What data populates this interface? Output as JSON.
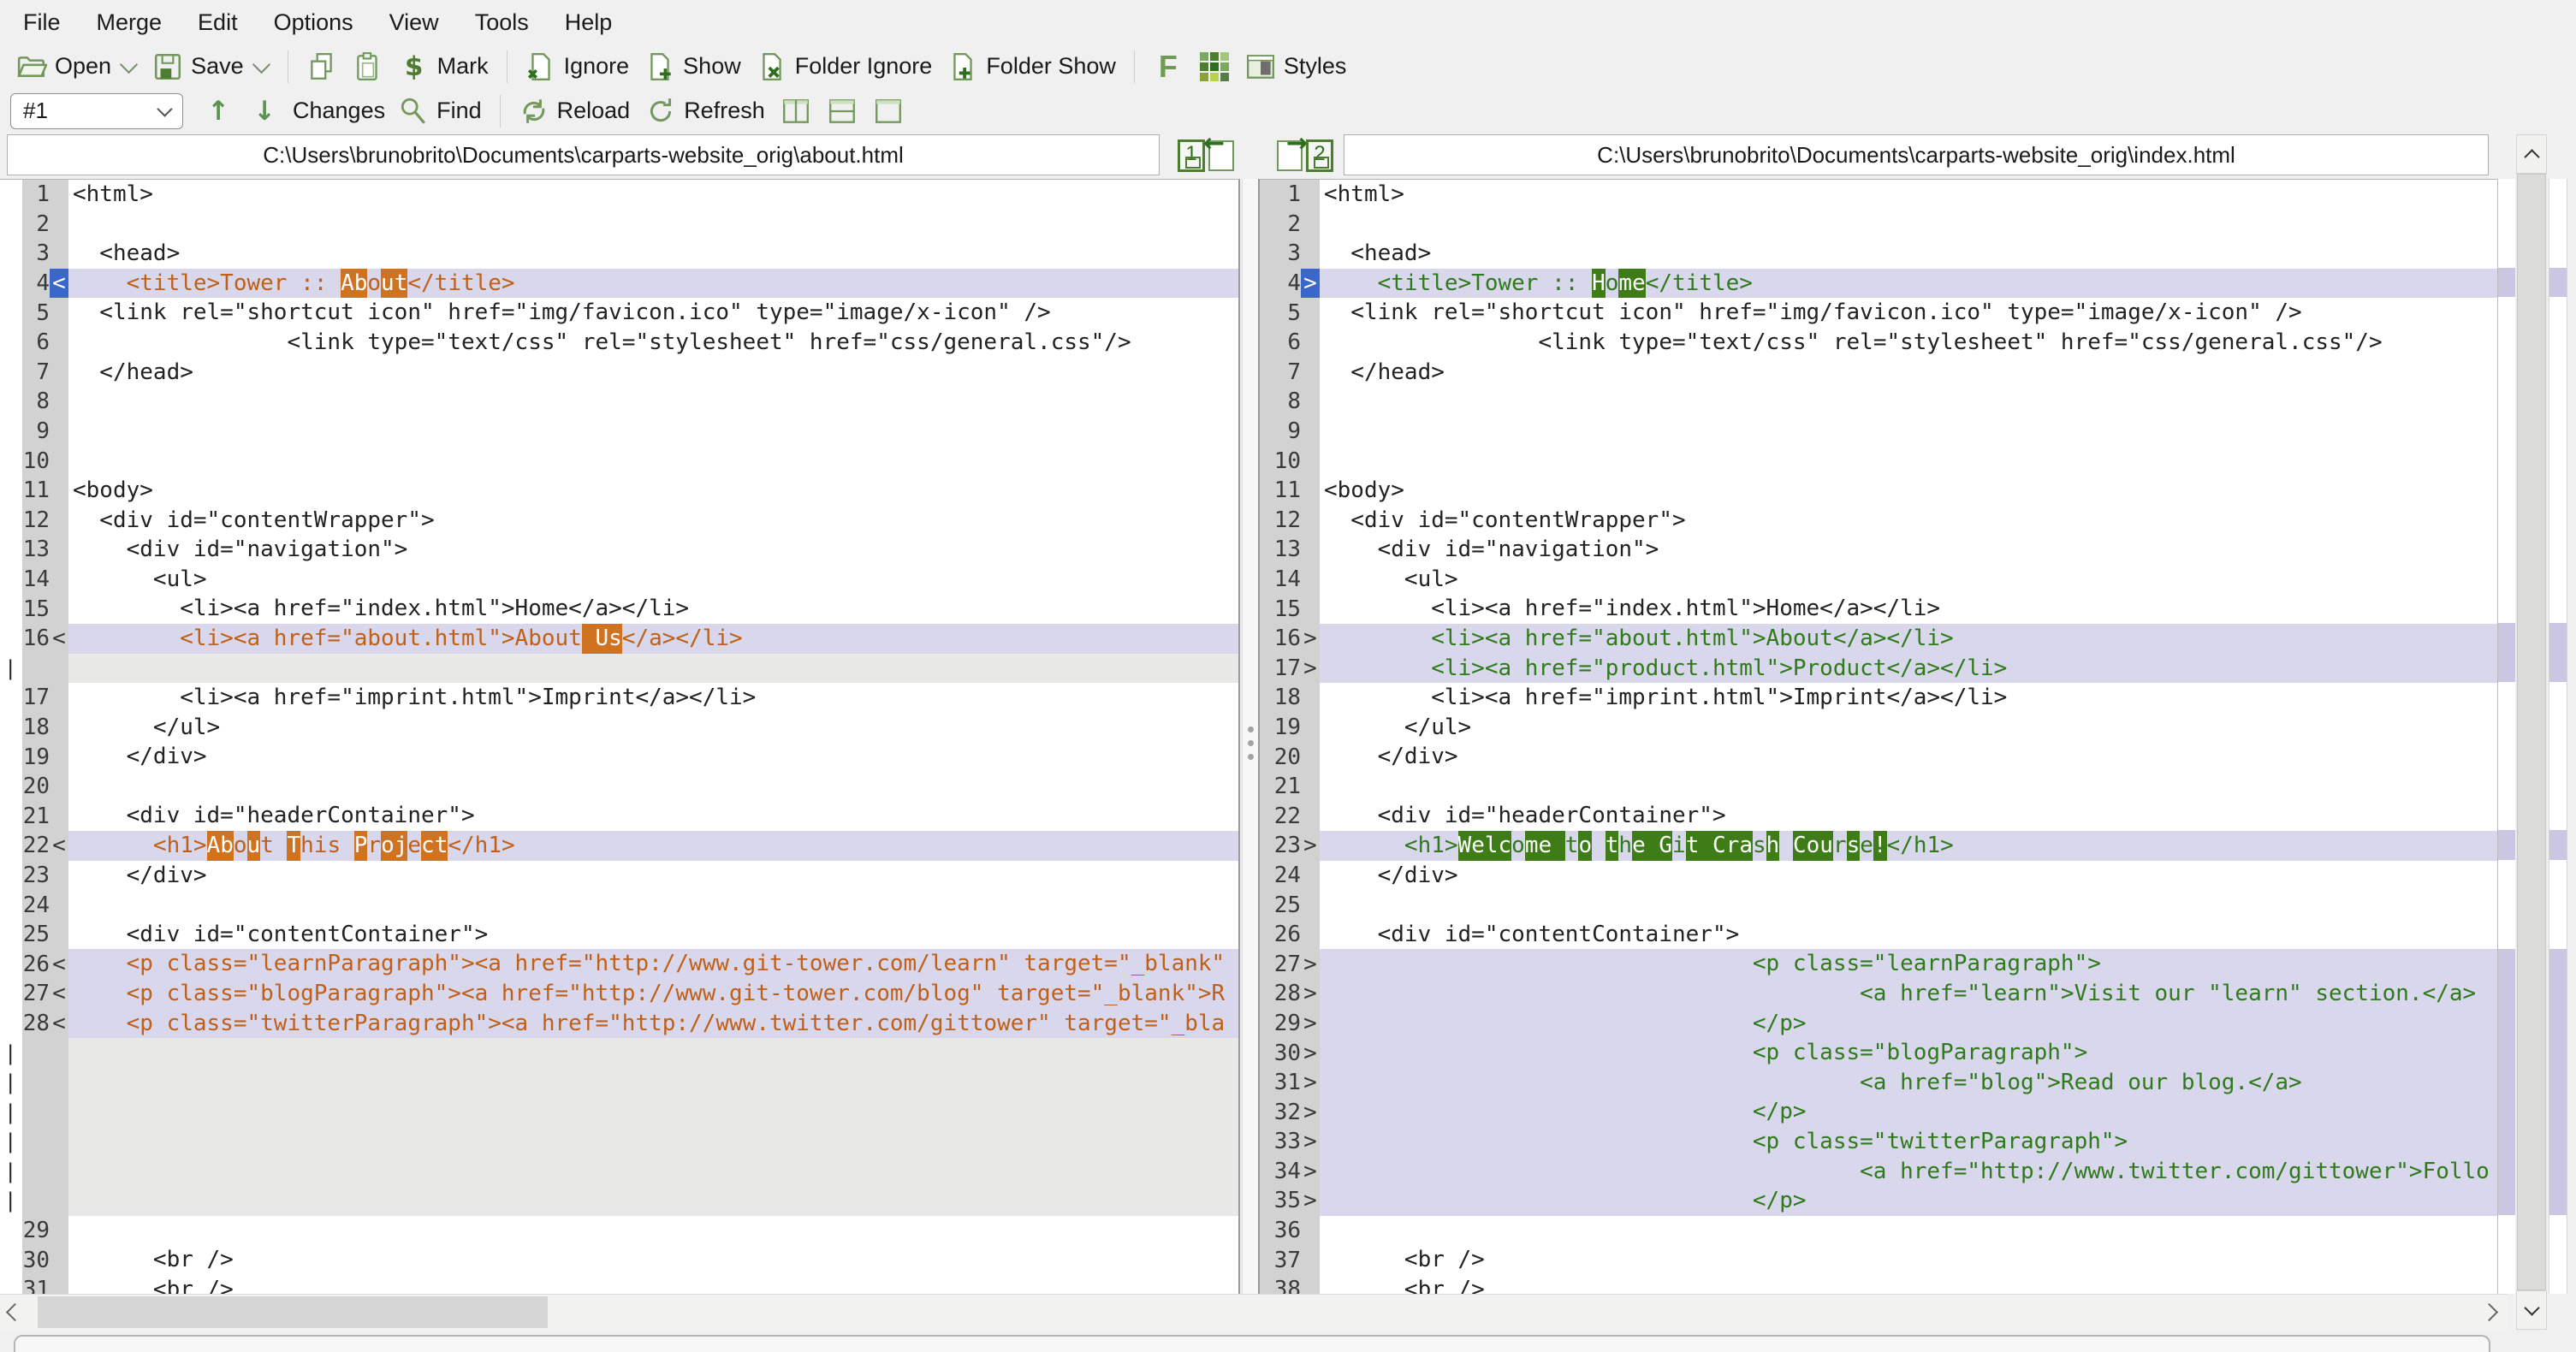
{
  "menu": {
    "items": [
      "File",
      "Merge",
      "Edit",
      "Options",
      "View",
      "Tools",
      "Help"
    ]
  },
  "toolbar_main": {
    "groups": [
      [
        {
          "icon": "open-folder-icon",
          "label": "Open",
          "dropdown": true
        },
        {
          "icon": "save-icon",
          "label": "Save",
          "dropdown": true
        }
      ],
      [
        {
          "icon": "copy-icon",
          "label": ""
        },
        {
          "icon": "paste-icon",
          "label": ""
        },
        {
          "icon": "mark-icon",
          "label": "Mark"
        }
      ],
      [
        {
          "icon": "line-ignore-icon",
          "label": "Ignore"
        },
        {
          "icon": "line-show-icon",
          "label": "Show"
        },
        {
          "icon": "folder-ignore-icon",
          "label": "Folder Ignore"
        },
        {
          "icon": "folder-show-icon",
          "label": "Folder Show"
        }
      ],
      [
        {
          "icon": "font-icon",
          "label": ""
        },
        {
          "icon": "color-grid-icon",
          "label": ""
        },
        {
          "icon": "styles-panel-icon",
          "label": "Styles"
        }
      ]
    ]
  },
  "toolbar_nav": {
    "diff_selector": "#1",
    "items": [
      {
        "icon": "up-arrow-icon",
        "label": ""
      },
      {
        "icon": "down-arrow-icon",
        "label": ""
      },
      {
        "label": "Changes"
      },
      {
        "icon": "find-icon",
        "label": "Find"
      },
      {
        "sep": true
      },
      {
        "icon": "reload-icon",
        "label": "Reload"
      },
      {
        "icon": "refresh-icon",
        "label": "Refresh"
      },
      {
        "icon": "layout-split-vertical-icon",
        "label": ""
      },
      {
        "icon": "layout-split-horizontal-icon",
        "label": ""
      },
      {
        "icon": "layout-single-icon",
        "label": ""
      }
    ]
  },
  "file_headers": {
    "left": "C:\\Users\\brunobrito\\Documents\\carparts-website_orig\\about.html",
    "right": "C:\\Users\\brunobrito\\Documents\\carparts-website_orig\\index.html"
  },
  "merge_buttons": {
    "to_left_label": "1",
    "to_right_label": "2"
  },
  "colors": {
    "diff_line_bg": "#d9d7ec",
    "filler_bg": "#e8e8e7",
    "gutter_bg": "#d2d2d2",
    "left_diff_text": "#c06018",
    "left_diff_block": "#cf7320",
    "right_diff_text": "#2f7a1b",
    "right_diff_block": "#3e7c18",
    "current_diff_marker": "#3a67cb",
    "overview_mark": "#cbc7e2",
    "toolbar_icon_green": "#4e7d32"
  },
  "overview_marks": [
    {
      "row": 3,
      "count": 1
    },
    {
      "row": 15,
      "count": 2
    },
    {
      "row": 22,
      "count": 1
    },
    {
      "row": 26,
      "count": 9
    }
  ],
  "panes": {
    "left": {
      "lines": [
        {
          "n": "1",
          "m": "",
          "t": "",
          "s": [
            [
              "<html>",
              0
            ]
          ]
        },
        {
          "n": "2",
          "m": "",
          "t": "",
          "s": []
        },
        {
          "n": "3",
          "m": "",
          "t": "",
          "s": [
            [
              "  <head>",
              0
            ]
          ]
        },
        {
          "n": "4",
          "m": "<",
          "t": "c",
          "s": [
            [
              "    <title>Tower :: ",
              0
            ],
            [
              "Ab",
              1
            ],
            [
              "o",
              0
            ],
            [
              "ut",
              1
            ],
            [
              "</title>",
              0
            ]
          ]
        },
        {
          "n": "5",
          "m": "",
          "t": "",
          "s": [
            [
              "  <link rel=\"shortcut icon\" href=\"img/favicon.ico\" type=\"image/x-icon\" />",
              0
            ]
          ]
        },
        {
          "n": "6",
          "m": "",
          "t": "",
          "s": [
            [
              "                <link type=\"text/css\" rel=\"stylesheet\" href=\"css/general.css\"/>",
              0
            ]
          ]
        },
        {
          "n": "7",
          "m": "",
          "t": "",
          "s": [
            [
              "  </head>",
              0
            ]
          ]
        },
        {
          "n": "8",
          "m": "",
          "t": "",
          "s": []
        },
        {
          "n": "9",
          "m": "",
          "t": "",
          "s": []
        },
        {
          "n": "10",
          "m": "",
          "t": "",
          "s": []
        },
        {
          "n": "11",
          "m": "",
          "t": "",
          "s": [
            [
              "<body>",
              0
            ]
          ]
        },
        {
          "n": "12",
          "m": "",
          "t": "",
          "s": [
            [
              "  <div id=\"contentWrapper\">",
              0
            ]
          ]
        },
        {
          "n": "13",
          "m": "",
          "t": "",
          "s": [
            [
              "    <div id=\"navigation\">",
              0
            ]
          ]
        },
        {
          "n": "14",
          "m": "",
          "t": "",
          "s": [
            [
              "      <ul>",
              0
            ]
          ]
        },
        {
          "n": "15",
          "m": "",
          "t": "",
          "s": [
            [
              "        <li><a href=\"index.html\">Home</a></li>",
              0
            ]
          ]
        },
        {
          "n": "16",
          "m": "<",
          "t": "d",
          "s": [
            [
              "        <li><a href=\"about.html\">About",
              0
            ],
            [
              " Us",
              1
            ],
            [
              "</a></li>",
              0
            ]
          ]
        },
        {
          "n": "",
          "m": "|",
          "t": "f",
          "s": []
        },
        {
          "n": "17",
          "m": "",
          "t": "",
          "s": [
            [
              "        <li><a href=\"imprint.html\">Imprint</a></li>",
              0
            ]
          ]
        },
        {
          "n": "18",
          "m": "",
          "t": "",
          "s": [
            [
              "      </ul>",
              0
            ]
          ]
        },
        {
          "n": "19",
          "m": "",
          "t": "",
          "s": [
            [
              "    </div>",
              0
            ]
          ]
        },
        {
          "n": "20",
          "m": "",
          "t": "",
          "s": []
        },
        {
          "n": "21",
          "m": "",
          "t": "",
          "s": [
            [
              "    <div id=\"headerContainer\">",
              0
            ]
          ]
        },
        {
          "n": "22",
          "m": "<",
          "t": "d",
          "s": [
            [
              "      <h1>",
              0
            ],
            [
              "Ab",
              1
            ],
            [
              "o",
              0
            ],
            [
              "u",
              1
            ],
            [
              "t ",
              0
            ],
            [
              "T",
              1
            ],
            [
              "his ",
              0
            ],
            [
              "P",
              1
            ],
            [
              "r",
              0
            ],
            [
              "oj",
              1
            ],
            [
              "e",
              0
            ],
            [
              "ct",
              1
            ],
            [
              "</h1>",
              0
            ]
          ]
        },
        {
          "n": "23",
          "m": "",
          "t": "",
          "s": [
            [
              "    </div>",
              0
            ]
          ]
        },
        {
          "n": "24",
          "m": "",
          "t": "",
          "s": []
        },
        {
          "n": "25",
          "m": "",
          "t": "",
          "s": [
            [
              "    <div id=\"contentContainer\">",
              0
            ]
          ]
        },
        {
          "n": "26",
          "m": "<",
          "t": "d",
          "s": [
            [
              "    <p class=\"learnParagraph\"><a href=\"http://www.git-tower.com/learn\" target=\"_blank\"",
              0
            ]
          ]
        },
        {
          "n": "27",
          "m": "<",
          "t": "d",
          "s": [
            [
              "    <p class=\"blogParagraph\"><a href=\"http://www.git-tower.com/blog\" target=\"_blank\">R",
              0
            ]
          ]
        },
        {
          "n": "28",
          "m": "<",
          "t": "d",
          "s": [
            [
              "    <p class=\"twitterParagraph\"><a href=\"http://www.twitter.com/gittower\" target=\"_bla",
              0
            ]
          ]
        },
        {
          "n": "",
          "m": "|",
          "t": "f",
          "s": []
        },
        {
          "n": "",
          "m": "|",
          "t": "f",
          "s": []
        },
        {
          "n": "",
          "m": "|",
          "t": "f",
          "s": []
        },
        {
          "n": "",
          "m": "|",
          "t": "f",
          "s": []
        },
        {
          "n": "",
          "m": "|",
          "t": "f",
          "s": []
        },
        {
          "n": "",
          "m": "|",
          "t": "f",
          "s": []
        },
        {
          "n": "29",
          "m": "",
          "t": "",
          "s": []
        },
        {
          "n": "30",
          "m": "",
          "t": "",
          "s": [
            [
              "      <br />",
              0
            ]
          ]
        },
        {
          "n": "31",
          "m": "",
          "t": "",
          "s": [
            [
              "      <br />",
              0
            ]
          ]
        }
      ]
    },
    "right": {
      "lines": [
        {
          "n": "1",
          "m": "",
          "t": "",
          "s": [
            [
              "<html>",
              0
            ]
          ]
        },
        {
          "n": "2",
          "m": "",
          "t": "",
          "s": []
        },
        {
          "n": "3",
          "m": "",
          "t": "",
          "s": [
            [
              "  <head>",
              0
            ]
          ]
        },
        {
          "n": "4",
          "m": ">",
          "t": "c",
          "s": [
            [
              "    <title>Tower :: ",
              0
            ],
            [
              "H",
              1
            ],
            [
              "o",
              0
            ],
            [
              "me",
              1
            ],
            [
              "</title>",
              0
            ]
          ]
        },
        {
          "n": "5",
          "m": "",
          "t": "",
          "s": [
            [
              "  <link rel=\"shortcut icon\" href=\"img/favicon.ico\" type=\"image/x-icon\" />",
              0
            ]
          ]
        },
        {
          "n": "6",
          "m": "",
          "t": "",
          "s": [
            [
              "                <link type=\"text/css\" rel=\"stylesheet\" href=\"css/general.css\"/>",
              0
            ]
          ]
        },
        {
          "n": "7",
          "m": "",
          "t": "",
          "s": [
            [
              "  </head>",
              0
            ]
          ]
        },
        {
          "n": "8",
          "m": "",
          "t": "",
          "s": []
        },
        {
          "n": "9",
          "m": "",
          "t": "",
          "s": []
        },
        {
          "n": "10",
          "m": "",
          "t": "",
          "s": []
        },
        {
          "n": "11",
          "m": "",
          "t": "",
          "s": [
            [
              "<body>",
              0
            ]
          ]
        },
        {
          "n": "12",
          "m": "",
          "t": "",
          "s": [
            [
              "  <div id=\"contentWrapper\">",
              0
            ]
          ]
        },
        {
          "n": "13",
          "m": "",
          "t": "",
          "s": [
            [
              "    <div id=\"navigation\">",
              0
            ]
          ]
        },
        {
          "n": "14",
          "m": "",
          "t": "",
          "s": [
            [
              "      <ul>",
              0
            ]
          ]
        },
        {
          "n": "15",
          "m": "",
          "t": "",
          "s": [
            [
              "        <li><a href=\"index.html\">Home</a></li>",
              0
            ]
          ]
        },
        {
          "n": "16",
          "m": ">",
          "t": "d",
          "s": [
            [
              "        <li><a href=\"about.html\">About</a></li>",
              0
            ]
          ]
        },
        {
          "n": "17",
          "m": ">",
          "t": "d",
          "s": [
            [
              "        <li><a href=\"product.html\">Product</a></li>",
              0
            ]
          ]
        },
        {
          "n": "18",
          "m": "",
          "t": "",
          "s": [
            [
              "        <li><a href=\"imprint.html\">Imprint</a></li>",
              0
            ]
          ]
        },
        {
          "n": "19",
          "m": "",
          "t": "",
          "s": [
            [
              "      </ul>",
              0
            ]
          ]
        },
        {
          "n": "20",
          "m": "",
          "t": "",
          "s": [
            [
              "    </div>",
              0
            ]
          ]
        },
        {
          "n": "21",
          "m": "",
          "t": "",
          "s": []
        },
        {
          "n": "22",
          "m": "",
          "t": "",
          "s": [
            [
              "    <div id=\"headerContainer\">",
              0
            ]
          ]
        },
        {
          "n": "23",
          "m": ">",
          "t": "d",
          "s": [
            [
              "      <h1>",
              0
            ],
            [
              "Welc",
              1
            ],
            [
              "o",
              0
            ],
            [
              "me ",
              1
            ],
            [
              "t",
              0
            ],
            [
              "o",
              1
            ],
            [
              " ",
              0
            ],
            [
              "t",
              1
            ],
            [
              "h",
              0
            ],
            [
              "e G",
              1
            ],
            [
              "i",
              0
            ],
            [
              "t Cra",
              1
            ],
            [
              "s",
              0
            ],
            [
              "h",
              1
            ],
            [
              " ",
              0
            ],
            [
              "Cou",
              1
            ],
            [
              "r",
              0
            ],
            [
              "s",
              1
            ],
            [
              "e",
              0
            ],
            [
              "!",
              1
            ],
            [
              "</h1>",
              0
            ]
          ]
        },
        {
          "n": "24",
          "m": "",
          "t": "",
          "s": [
            [
              "    </div>",
              0
            ]
          ]
        },
        {
          "n": "25",
          "m": "",
          "t": "",
          "s": []
        },
        {
          "n": "26",
          "m": "",
          "t": "",
          "s": [
            [
              "    <div id=\"contentContainer\">",
              0
            ]
          ]
        },
        {
          "n": "27",
          "m": ">",
          "t": "d",
          "s": [
            [
              "                                <p class=\"learnParagraph\">",
              0
            ]
          ]
        },
        {
          "n": "28",
          "m": ">",
          "t": "d",
          "s": [
            [
              "                                        <a href=\"learn\">Visit our \"learn\" section.</a>",
              0
            ]
          ]
        },
        {
          "n": "29",
          "m": ">",
          "t": "d",
          "s": [
            [
              "                                </p>",
              0
            ]
          ]
        },
        {
          "n": "30",
          "m": ">",
          "t": "d",
          "s": [
            [
              "                                <p class=\"blogParagraph\">",
              0
            ]
          ]
        },
        {
          "n": "31",
          "m": ">",
          "t": "d",
          "s": [
            [
              "                                        <a href=\"blog\">Read our blog.</a>",
              0
            ]
          ]
        },
        {
          "n": "32",
          "m": ">",
          "t": "d",
          "s": [
            [
              "                                </p>",
              0
            ]
          ]
        },
        {
          "n": "33",
          "m": ">",
          "t": "d",
          "s": [
            [
              "                                <p class=\"twitterParagraph\">",
              0
            ]
          ]
        },
        {
          "n": "34",
          "m": ">",
          "t": "d",
          "s": [
            [
              "                                        <a href=\"http://www.twitter.com/gittower\">Follo",
              0
            ]
          ]
        },
        {
          "n": "35",
          "m": ">",
          "t": "d",
          "s": [
            [
              "                                </p>",
              0
            ]
          ]
        },
        {
          "n": "36",
          "m": "",
          "t": "",
          "s": []
        },
        {
          "n": "37",
          "m": "",
          "t": "",
          "s": [
            [
              "      <br />",
              0
            ]
          ]
        },
        {
          "n": "38",
          "m": "",
          "t": "",
          "s": [
            [
              "      <br />",
              0
            ]
          ]
        }
      ]
    }
  }
}
